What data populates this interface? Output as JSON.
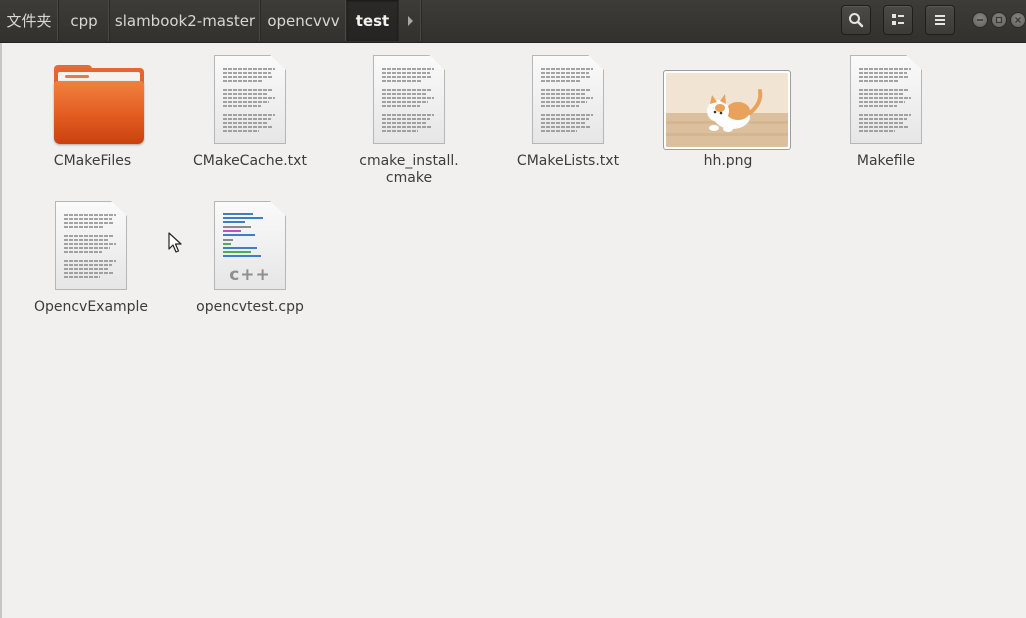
{
  "breadcrumbs": [
    {
      "label": "文件夹"
    },
    {
      "label": "cpp"
    },
    {
      "label": "slambook2-master"
    },
    {
      "label": "opencvvv"
    },
    {
      "label": "test",
      "active": true
    }
  ],
  "toolbar": {
    "search_icon": "search-icon",
    "view_toggle_icon": "grid-view-icon",
    "menu_icon": "hamburger-menu-icon"
  },
  "window_controls": [
    "minimize",
    "maximize",
    "close"
  ],
  "files": [
    {
      "name": "CMakeFiles",
      "type": "folder"
    },
    {
      "name": "CMakeCache.txt",
      "type": "text"
    },
    {
      "name": "cmake_install.\ncmake",
      "type": "text"
    },
    {
      "name": "CMakeLists.txt",
      "type": "text"
    },
    {
      "name": "hh.png",
      "type": "image"
    },
    {
      "name": "Makefile",
      "type": "text"
    },
    {
      "name": "OpencvExample",
      "type": "text"
    },
    {
      "name": "opencvtest.cpp",
      "type": "cpp",
      "badge": "c++"
    }
  ],
  "colors": {
    "header_bg": "#3c3b37",
    "content_bg": "#f1f0ee",
    "folder_orange": "#e25c21"
  }
}
